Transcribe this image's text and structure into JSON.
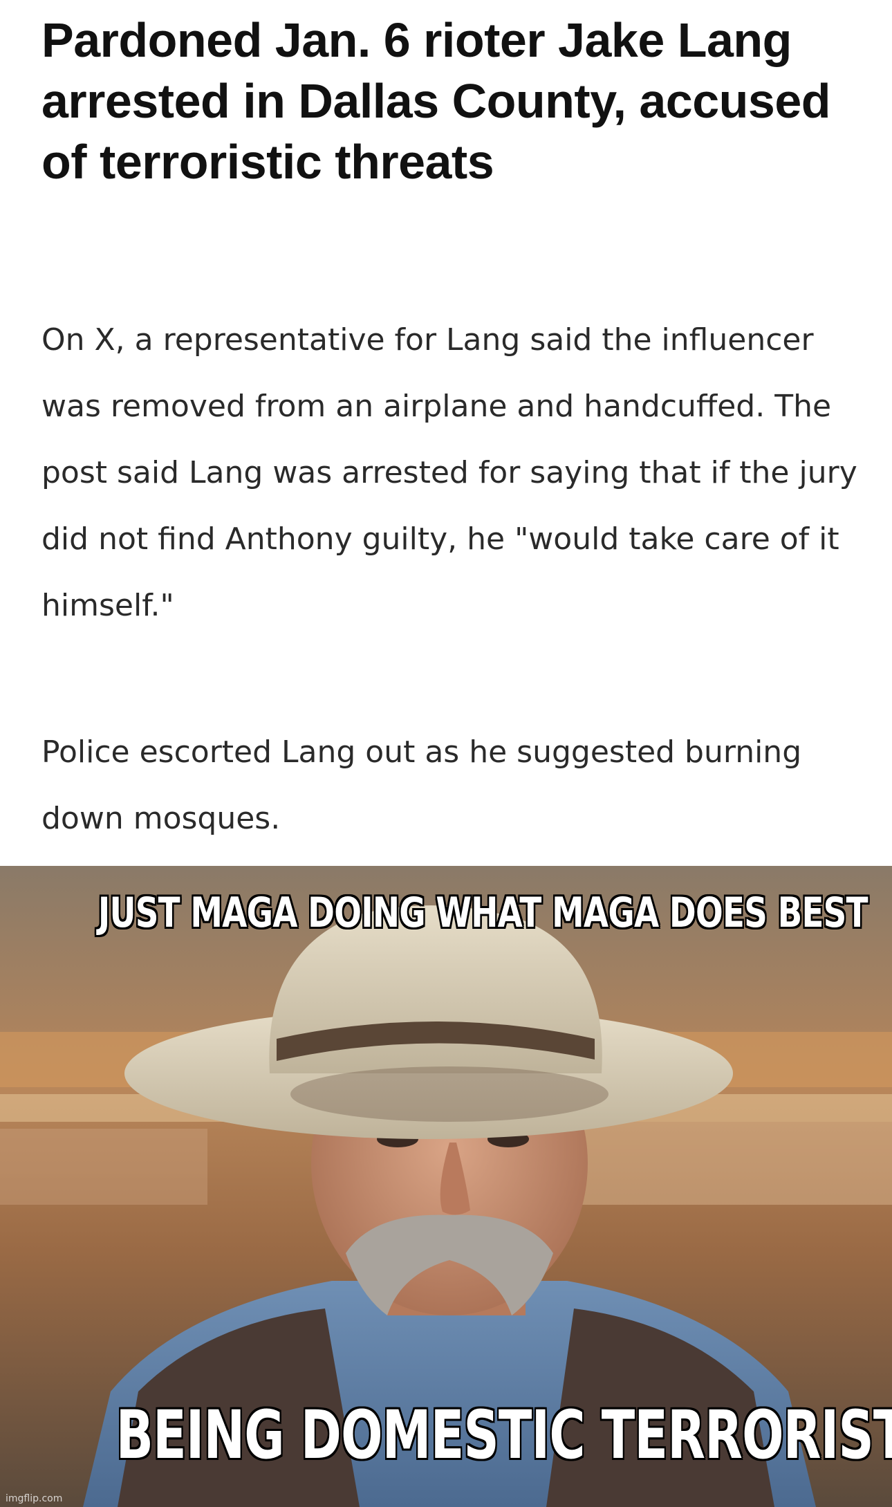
{
  "article": {
    "headline": "Pardoned Jan. 6 rioter Jake Lang arrested in Dallas County, accused of terroristic threats",
    "paragraphs": [
      "On X, a representative for Lang said the influencer was removed from an airplane and handcuffed. The post said Lang was arrested for saying that if the jury did not find Anthony guilty, he \"would take care of it himself.\"",
      "Police escorted Lang out as he suggested burning down mosques."
    ]
  },
  "meme": {
    "top_caption": "JUST MAGA DOING WHAT MAGA DOES BEST",
    "bottom_caption": "BEING DOMESTIC TERRORISTS",
    "watermark": "imgflip.com",
    "image_subject": "man in cowboy hat with gray mustache"
  }
}
